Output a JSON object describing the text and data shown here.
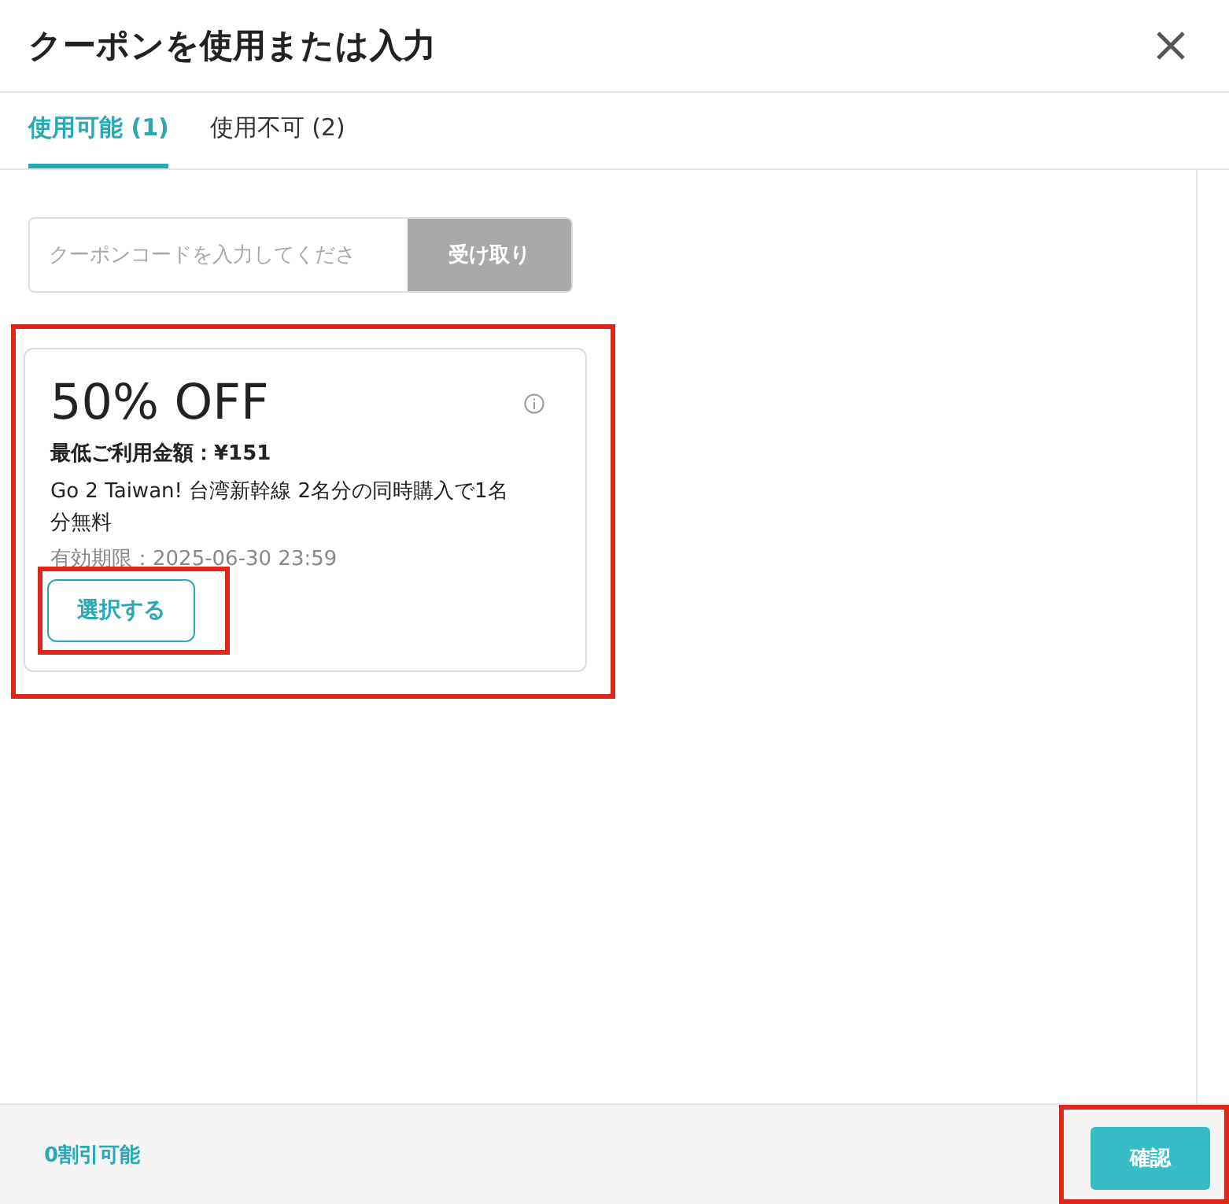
{
  "dialog": {
    "title": "クーポンを使用または入力"
  },
  "tabs": [
    {
      "label": "使用可能 (1)",
      "selected": true
    },
    {
      "label": "使用不可 (2)",
      "selected": false
    }
  ],
  "code_entry": {
    "placeholder": "クーポンコードを入力してくださ",
    "button": "受け取り",
    "disabled": true
  },
  "coupons": [
    {
      "discount": "50% OFF",
      "minimum": "最低ご利用金額：¥151",
      "description": "Go 2 Taiwan! 台湾新幹線 2名分の同時購入で1名分無料",
      "expiry": "有効期限：2025-06-30 23:59",
      "button": "選択する",
      "highlighted": true,
      "button_highlighted": true
    }
  ],
  "footer": {
    "summary": "0割引可能",
    "confirm": "確認",
    "confirm_highlighted": true
  }
}
